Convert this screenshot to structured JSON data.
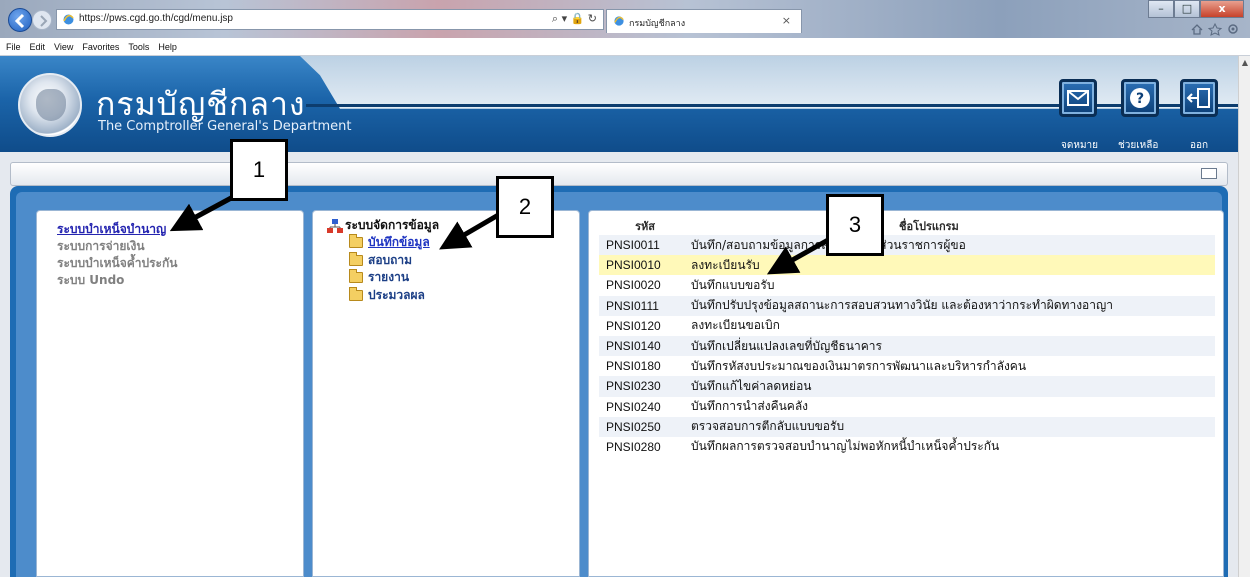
{
  "browser": {
    "url": "https://pws.cgd.go.th/cgd/menu.jsp",
    "address_tools": "⌕ ▾ 🔒 ↻",
    "tab_title": "กรมบัญชีกลาง",
    "tab_close": "×",
    "menu": [
      "File",
      "Edit",
      "View",
      "Favorites",
      "Tools",
      "Help"
    ],
    "window_buttons": [
      "–",
      "□",
      "x"
    ]
  },
  "header": {
    "title": "กรมบัญชีกลาง",
    "subtitle": "The Comptroller General's Department",
    "buttons": [
      {
        "label": "จดหมาย",
        "icon": "mail-icon"
      },
      {
        "label": "ช่วยเหลือ",
        "icon": "help-icon"
      },
      {
        "label": "ออก",
        "icon": "logout-icon"
      }
    ]
  },
  "left_nav": {
    "items": [
      {
        "label": "ระบบบำเหน็จบำนาญ",
        "active": true
      },
      {
        "label": "ระบบการจ่ายเงิน",
        "active": false
      },
      {
        "label": "ระบบบำเหน็จค้ำประกัน",
        "active": false
      },
      {
        "label": "ระบบ Undo",
        "active": false
      }
    ]
  },
  "tree": {
    "root": "ระบบจัดการข้อมูล",
    "items": [
      {
        "label": "บันทึกข้อมูล",
        "selected": true
      },
      {
        "label": "สอบถาม",
        "selected": false
      },
      {
        "label": "รายงาน",
        "selected": false
      },
      {
        "label": "ประมวลผล",
        "selected": false
      }
    ]
  },
  "programs": {
    "col_code": "รหัส",
    "col_name": "ชื่อโปรแกรม",
    "rows": [
      {
        "code": "PNSI0011",
        "name": "บันทึก/สอบถามข้อมูลการส่งเรื่องของส่วนราชการผู้ขอ"
      },
      {
        "code": "PNSI0010",
        "name": "ลงทะเบียนรับ",
        "highlight": true
      },
      {
        "code": "PNSI0020",
        "name": "บันทึกแบบขอรับ"
      },
      {
        "code": "PNSI0111",
        "name": "บันทึกปรับปรุงข้อมูลสถานะการสอบสวนทางวินัย และต้องหาว่ากระทำผิดทางอาญา"
      },
      {
        "code": "PNSI0120",
        "name": "ลงทะเบียนขอเบิก"
      },
      {
        "code": "PNSI0140",
        "name": "บันทึกเปลี่ยนแปลงเลขที่บัญชีธนาคาร"
      },
      {
        "code": "PNSI0180",
        "name": "บันทึกรหัสงบประมาณของเงินมาตรการพัฒนาและบริหารกำลังคน"
      },
      {
        "code": "PNSI0230",
        "name": "บันทึกแก้ไขค่าลดหย่อน"
      },
      {
        "code": "PNSI0240",
        "name": "บันทึกการนำส่งคืนคลัง"
      },
      {
        "code": "PNSI0250",
        "name": "ตรวจสอบการตีกลับแบบขอรับ"
      },
      {
        "code": "PNSI0280",
        "name": "บันทึกผลการตรวจสอบบำนาญไม่พอหักหนี้บำเหน็จค้ำประกัน"
      }
    ]
  },
  "callouts": [
    "1",
    "2",
    "3"
  ],
  "colors": {
    "header_blue": "#1b64a9",
    "link_active": "#2424b0",
    "row_highlight": "#fff9b9"
  }
}
